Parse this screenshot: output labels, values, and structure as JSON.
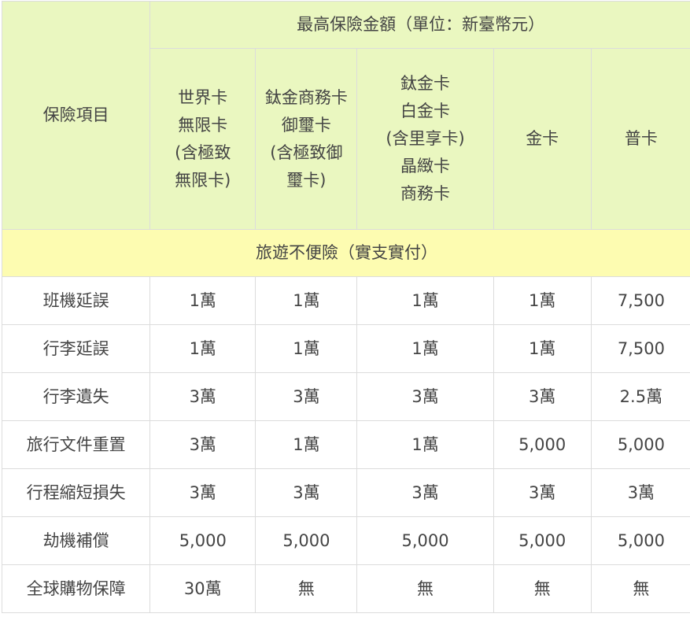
{
  "table": {
    "item_header": "保險項目",
    "amount_header": "最高保險金額（單位：新臺幣元）",
    "columns": [
      [
        "世界卡",
        "無限卡",
        "(含極致",
        "無限卡)"
      ],
      [
        "鈦金商務卡",
        "御璽卡",
        "(含極致御",
        "璽卡)"
      ],
      [
        "鈦金卡",
        "白金卡",
        "(含里享卡)",
        "晶緻卡",
        "商務卡"
      ],
      [
        "金卡"
      ],
      [
        "普卡"
      ]
    ],
    "section_title": "旅遊不便險（實支實付）",
    "rows": [
      {
        "item": "班機延誤",
        "values": [
          "1萬",
          "1萬",
          "1萬",
          "1萬",
          "7,500"
        ]
      },
      {
        "item": "行李延誤",
        "values": [
          "1萬",
          "1萬",
          "1萬",
          "1萬",
          "7,500"
        ]
      },
      {
        "item": "行李遺失",
        "values": [
          "3萬",
          "3萬",
          "3萬",
          "3萬",
          "2.5萬"
        ]
      },
      {
        "item": "旅行文件重置",
        "values": [
          "3萬",
          "1萬",
          "1萬",
          "5,000",
          "5,000"
        ]
      },
      {
        "item": "行程縮短損失",
        "values": [
          "3萬",
          "3萬",
          "3萬",
          "3萬",
          "3萬"
        ]
      },
      {
        "item": "劫機補償",
        "values": [
          "5,000",
          "5,000",
          "5,000",
          "5,000",
          "5,000"
        ]
      },
      {
        "item": "全球購物保障",
        "values": [
          "30萬",
          "無",
          "無",
          "無",
          "無"
        ]
      }
    ]
  }
}
